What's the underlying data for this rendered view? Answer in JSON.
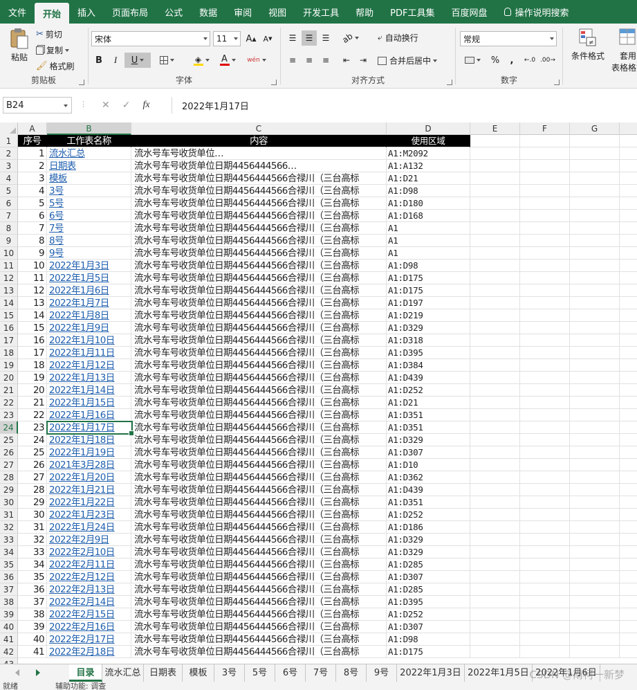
{
  "ribbon_tabs": [
    "文件",
    "开始",
    "插入",
    "页面布局",
    "公式",
    "数据",
    "审阅",
    "视图",
    "开发工具",
    "帮助",
    "PDF工具集",
    "百度网盘",
    "操作说明搜索"
  ],
  "clipboard": {
    "paste_label": "粘贴",
    "cut_label": "剪切",
    "copy_label": "复制",
    "format_painter_label": "格式刷",
    "group_label": "剪贴板"
  },
  "font": {
    "name": "宋体",
    "size": "11",
    "bold": "B",
    "italic": "I",
    "underline": "U",
    "grow": "A",
    "shrink": "A",
    "font_color": "A",
    "phonetic": "wén",
    "group_label": "字体"
  },
  "alignment": {
    "wrap_text_label": "自动换行",
    "merge_center_label": "合并后居中",
    "group_label": "对齐方式"
  },
  "number": {
    "format": "常规",
    "percent": "%",
    "comma": ",",
    "group_label": "数字"
  },
  "styles": {
    "conditional_label": "条件格式",
    "table_label_1": "套用",
    "table_label_2": "表格格式"
  },
  "formula_bar": {
    "name_box": "B24",
    "fx": "fx",
    "value": "2022年1月17日"
  },
  "columns": [
    "A",
    "B",
    "C",
    "D",
    "E",
    "F",
    "G"
  ],
  "header_row": {
    "a": "序号",
    "b": "工作表名称",
    "c": "内容",
    "d": "使用区域"
  },
  "rows": [
    {
      "n": "1",
      "b": "流水汇总",
      "c": "流水号车号收货单位…",
      "d": "A1:M2092"
    },
    {
      "n": "2",
      "b": "日期表",
      "c": "流水号车号收货单位日期4456444566…",
      "d": "A1:A132"
    },
    {
      "n": "3",
      "b": "模板",
      "c": "流水号车号收货单位日期4456444566合禄川（三台高标",
      "d": "A1:D21"
    },
    {
      "n": "4",
      "b": "3号",
      "c": "流水号车号收货单位日期4456444566合禄川（三台高标",
      "d": "A1:D98"
    },
    {
      "n": "5",
      "b": "5号",
      "c": "流水号车号收货单位日期4456444566合禄川（三台高标",
      "d": "A1:D180"
    },
    {
      "n": "6",
      "b": "6号",
      "c": "流水号车号收货单位日期4456444566合禄川（三台高标",
      "d": "A1:D168"
    },
    {
      "n": "7",
      "b": "7号",
      "c": "流水号车号收货单位日期4456444566合禄川（三台高标",
      "d": "A1"
    },
    {
      "n": "8",
      "b": "8号",
      "c": "流水号车号收货单位日期4456444566合禄川（三台高标",
      "d": "A1"
    },
    {
      "n": "9",
      "b": "9号",
      "c": "流水号车号收货单位日期4456444566合禄川（三台高标",
      "d": "A1"
    },
    {
      "n": "10",
      "b": "2022年1月3日",
      "c": "流水号车号收货单位日期4456444566合禄川（三台高标",
      "d": "A1:D98"
    },
    {
      "n": "11",
      "b": "2022年1月5日",
      "c": "流水号车号收货单位日期4456444566合禄川（三台高标",
      "d": "A1:D175"
    },
    {
      "n": "12",
      "b": "2022年1月6日",
      "c": "流水号车号收货单位日期4456444566合禄川（三台高标",
      "d": "A1:D175"
    },
    {
      "n": "13",
      "b": "2022年1月7日",
      "c": "流水号车号收货单位日期4456444566合禄川（三台高标",
      "d": "A1:D197"
    },
    {
      "n": "14",
      "b": "2022年1月8日",
      "c": "流水号车号收货单位日期4456444566合禄川（三台高标",
      "d": "A1:D219"
    },
    {
      "n": "15",
      "b": "2022年1月9日",
      "c": "流水号车号收货单位日期4456444566合禄川（三台高标",
      "d": "A1:D329"
    },
    {
      "n": "16",
      "b": "2022年1月10日",
      "c": "流水号车号收货单位日期4456444566合禄川（三台高标",
      "d": "A1:D318"
    },
    {
      "n": "17",
      "b": "2022年1月11日",
      "c": "流水号车号收货单位日期4456444566合禄川（三台高标",
      "d": "A1:D395"
    },
    {
      "n": "18",
      "b": "2022年1月12日",
      "c": "流水号车号收货单位日期4456444566合禄川（三台高标",
      "d": "A1:D384"
    },
    {
      "n": "19",
      "b": "2022年1月13日",
      "c": "流水号车号收货单位日期4456444566合禄川（三台高标",
      "d": "A1:D439"
    },
    {
      "n": "20",
      "b": "2022年1月14日",
      "c": "流水号车号收货单位日期4456444566合禄川（三台高标",
      "d": "A1:D252"
    },
    {
      "n": "21",
      "b": "2022年1月15日",
      "c": "流水号车号收货单位日期4456444566合禄川（三台高标",
      "d": "A1:D21"
    },
    {
      "n": "22",
      "b": "2022年1月16日",
      "c": "流水号车号收货单位日期4456444566合禄川（三台高标",
      "d": "A1:D351"
    },
    {
      "n": "23",
      "b": "2022年1月17日",
      "c": "流水号车号收货单位日期4456444566合禄川（三台高标",
      "d": "A1:D351"
    },
    {
      "n": "24",
      "b": "2022年1月18日",
      "c": "流水号车号收货单位日期4456444566合禄川（三台高标",
      "d": "A1:D329"
    },
    {
      "n": "25",
      "b": "2022年1月19日",
      "c": "流水号车号收货单位日期4456444566合禄川（三台高标",
      "d": "A1:D307"
    },
    {
      "n": "26",
      "b": "2021年3月28日",
      "c": "流水号车号收货单位日期4456444566合禄川（三台高标",
      "d": "A1:D10"
    },
    {
      "n": "27",
      "b": "2022年1月20日",
      "c": "流水号车号收货单位日期4456444566合禄川（三台高标",
      "d": "A1:D362"
    },
    {
      "n": "28",
      "b": "2022年1月21日",
      "c": "流水号车号收货单位日期4456444566合禄川（三台高标",
      "d": "A1:D439"
    },
    {
      "n": "29",
      "b": "2022年1月22日",
      "c": "流水号车号收货单位日期4456444566合禄川（三台高标",
      "d": "A1:D351"
    },
    {
      "n": "30",
      "b": "2022年1月23日",
      "c": "流水号车号收货单位日期4456444566合禄川（三台高标",
      "d": "A1:D252"
    },
    {
      "n": "31",
      "b": "2022年1月24日",
      "c": "流水号车号收货单位日期4456444566合禄川（三台高标",
      "d": "A1:D186"
    },
    {
      "n": "32",
      "b": "2022年2月9日",
      "c": "流水号车号收货单位日期4456444566合禄川（三台高标",
      "d": "A1:D329"
    },
    {
      "n": "33",
      "b": "2022年2月10日",
      "c": "流水号车号收货单位日期4456444566合禄川（三台高标",
      "d": "A1:D329"
    },
    {
      "n": "34",
      "b": "2022年2月11日",
      "c": "流水号车号收货单位日期4456444566合禄川（三台高标",
      "d": "A1:D285"
    },
    {
      "n": "35",
      "b": "2022年2月12日",
      "c": "流水号车号收货单位日期4456444566合禄川（三台高标",
      "d": "A1:D307"
    },
    {
      "n": "36",
      "b": "2022年2月13日",
      "c": "流水号车号收货单位日期4456444566合禄川（三台高标",
      "d": "A1:D285"
    },
    {
      "n": "37",
      "b": "2022年2月14日",
      "c": "流水号车号收货单位日期4456444566合禄川（三台高标",
      "d": "A1:D395"
    },
    {
      "n": "38",
      "b": "2022年2月15日",
      "c": "流水号车号收货单位日期4456444566合禄川（三台高标",
      "d": "A1:D252"
    },
    {
      "n": "39",
      "b": "2022年2月16日",
      "c": "流水号车号收货单位日期4456444566合禄川（三台高标",
      "d": "A1:D307"
    },
    {
      "n": "40",
      "b": "2022年2月17日",
      "c": "流水号车号收货单位日期4456444566合禄川（三台高标",
      "d": "A1:D98"
    },
    {
      "n": "41",
      "b": "2022年2月18日",
      "c": "流水号车号收货单位日期4456444566合禄川（三台高标",
      "d": "A1:D175"
    }
  ],
  "selected_cell": "B24",
  "sheet_tabs": [
    "目录",
    "流水汇总",
    "日期表",
    "模板",
    "3号",
    "5号",
    "6号",
    "7号",
    "8号",
    "9号",
    "2022年1月3日",
    "2022年1月5日",
    "2022年1月6日"
  ],
  "active_sheet": "目录",
  "status": {
    "ready": "就绪",
    "accessibility": "辅助功能: 调查"
  },
  "watermark": "CSDN @南柯一新梦",
  "colors": {
    "accent": "#217346",
    "link": "#1f5fae",
    "header_bg": "#000000"
  }
}
